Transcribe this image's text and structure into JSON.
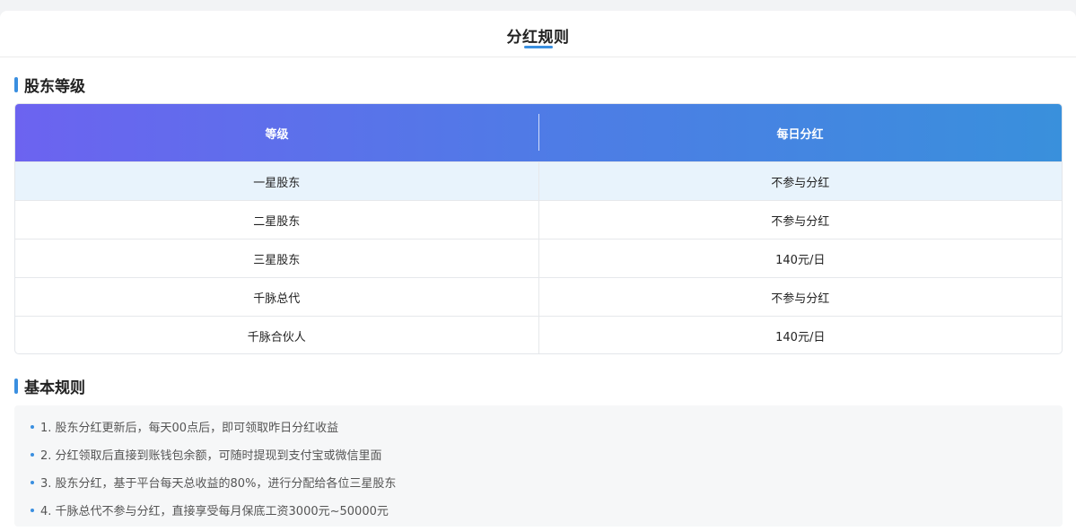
{
  "header": {
    "title": "分红规则"
  },
  "levels_section": {
    "title": "股东等级"
  },
  "table": {
    "columns": [
      "等级",
      "每日分红"
    ],
    "rows": [
      {
        "level": "一星股东",
        "daily": "不参与分红"
      },
      {
        "level": "二星股东",
        "daily": "不参与分红"
      },
      {
        "level": "三星股东",
        "daily": "140元/日"
      },
      {
        "level": "千脉总代",
        "daily": "不参与分红"
      },
      {
        "level": "千脉合伙人",
        "daily": "140元/日"
      }
    ]
  },
  "rules_section": {
    "title": "基本规则",
    "items": [
      "1. 股东分红更新后，每天00点后，即可领取昨日分红收益",
      "2. 分红领取后直接到账钱包余额，可随时提现到支付宝或微信里面",
      "3. 股东分红，基于平台每天总收益的80%，进行分配给各位三星股东",
      "4. 千脉总代不参与分红，直接享受每月保底工资3000元~50000元"
    ]
  },
  "colors": {
    "accent": "#3a8fe0",
    "header_gradient_start": "#6c63f0",
    "header_gradient_end": "#3990dc",
    "highlight_row": "#e8f3fc"
  }
}
